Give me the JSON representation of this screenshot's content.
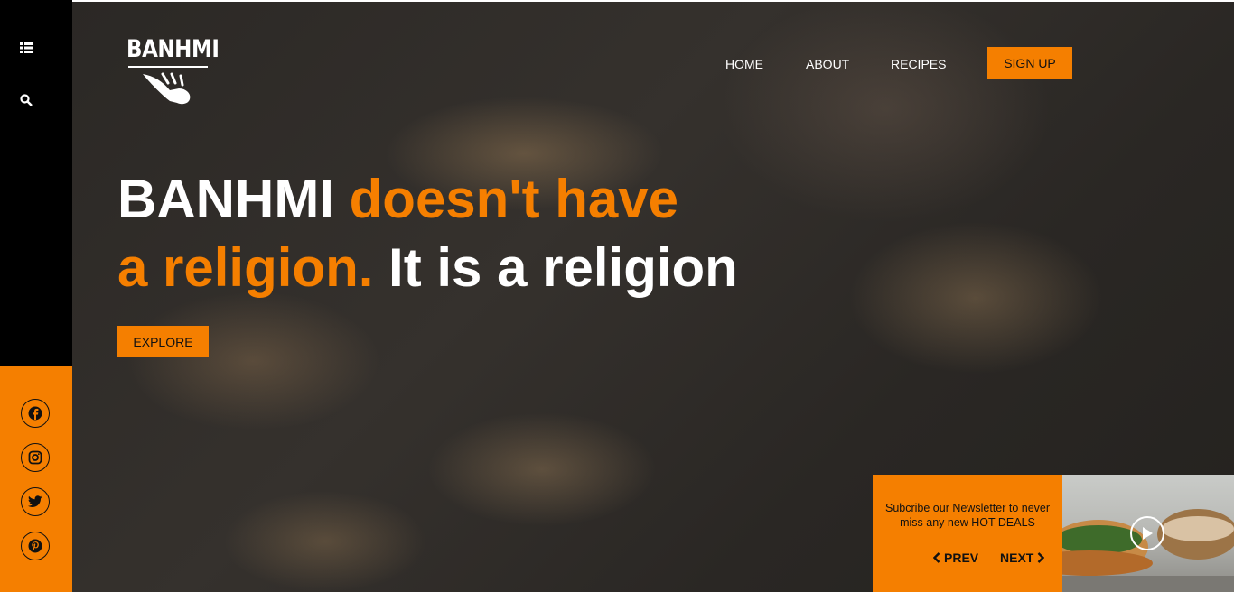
{
  "brand": {
    "logo_text": "BANHMI"
  },
  "nav": {
    "home": "HOME",
    "about": "ABOUT",
    "recipes": "RECIPES",
    "signup": "SIGN UP"
  },
  "hero": {
    "line1_white": "BANHMI ",
    "line1_orange": "doesn't have",
    "line2_orange": "a religion.",
    "line2_white": " It is a religion",
    "explore": "EXPLORE"
  },
  "sidebar": {
    "icons": [
      "grid-icon",
      "search-icon"
    ],
    "social": [
      "facebook-icon",
      "instagram-icon",
      "twitter-icon",
      "pinterest-icon"
    ]
  },
  "newsletter": {
    "message": "Subcribe our Newsletter to never miss any new HOT DEALS",
    "prev": "PREV",
    "next": "NEXT"
  },
  "colors": {
    "accent": "#f57f00",
    "sidebar": "#000000"
  }
}
